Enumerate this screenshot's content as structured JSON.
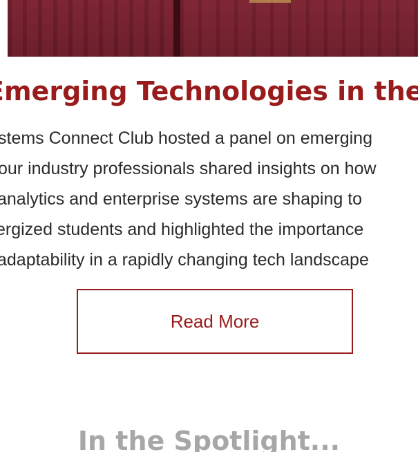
{
  "hero": {
    "image_name": "event-photo"
  },
  "article": {
    "headline": "Emerging Technologies in the Workforce",
    "body_lines": [
      "stems Connect Club hosted a panel on emerging",
      "our industry professionals shared insights on how",
      "analytics and enterprise systems are shaping to",
      "ergized students and highlighted the importance",
      "adaptability in a rapidly changing tech landscape"
    ],
    "read_more_label": "Read More"
  },
  "spotlight": {
    "heading": "In the Spotlight..."
  },
  "colors": {
    "accent": "#991b1b",
    "body_text": "#2b2b2b",
    "muted_heading": "#a7a7a7"
  }
}
